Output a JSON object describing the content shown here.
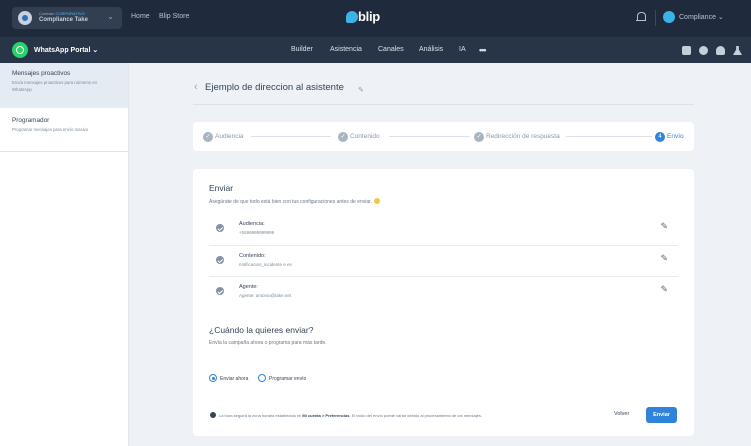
{
  "topbar": {
    "contract_kind_prefix": "Contrato",
    "contract_kind": "CORPORATIVO",
    "contract_name": "Compliance Take",
    "links": [
      "Home",
      "Blip Store"
    ],
    "logo_text": "blip",
    "tenant_name": "Compliance"
  },
  "botbar": {
    "bot_name": "WhatsApp Portal",
    "tabs": [
      "Builder",
      "Asistencia",
      "Canales",
      "Análisis",
      "IA"
    ],
    "more_label": "•••"
  },
  "sidebar": {
    "items": [
      {
        "title": "Mensajes proactivos",
        "description": "Envía mensajes proactivos para números en WhatsApp",
        "active": true
      },
      {
        "title": "Programador",
        "description": "Programar mensajes para envío masivo",
        "active": false
      }
    ]
  },
  "page": {
    "back_icon": "‹",
    "title": "Ejemplo de direccion al asistente",
    "edit_icon": "✎"
  },
  "stepper": {
    "steps": [
      {
        "label": "Audiencia",
        "icon": "✓"
      },
      {
        "label": "Contenido",
        "icon": "✓"
      },
      {
        "label": "Redirección de respuesta",
        "icon": "✓"
      },
      {
        "label": "Envío",
        "icon": "4"
      }
    ],
    "current": 4
  },
  "send": {
    "title": "Enviar",
    "description": "Asegúrate de que todo está bien con tus configuraciones antes de enviar.",
    "summary": [
      {
        "label": "Audiencia:",
        "value": "+5599999999999",
        "edit_icon": "✎"
      },
      {
        "label": "Contenido:",
        "value": "notificacion_incidente e es",
        "edit_icon": "✎"
      },
      {
        "label": "Agente:",
        "value": "Agente: antonio@take.net",
        "edit_icon": "✎"
      }
    ],
    "when_title": "¿Cuándo la quieres enviar?",
    "when_description": "Envía la campaña ahora o programa para más tarde.",
    "options": [
      {
        "label": "Enviar ahora",
        "checked": true
      },
      {
        "label": "Programar envío",
        "checked": false
      }
    ],
    "info_pre": "La hora seguirá la zona horaria establecida en",
    "info_bold": "Mi cuenta > Preferencias",
    "info_post": ". El inicio del envío puede variar debido al procesamiento de los mensajes.",
    "back_label": "Volver",
    "send_label": "Enviar"
  },
  "colors": {
    "topbar_bg": "#1f2a3c",
    "navbar_bg": "#283549",
    "accent": "#2f83d8",
    "whatsapp": "#25d366",
    "brand": "#3ab3e6"
  },
  "icons": {
    "chevron": "chevron-down-icon",
    "bell": "bell-icon",
    "puzzle": "puzzle-icon",
    "gear": "gear-icon",
    "users": "users-icon",
    "flask": "flask-icon"
  }
}
